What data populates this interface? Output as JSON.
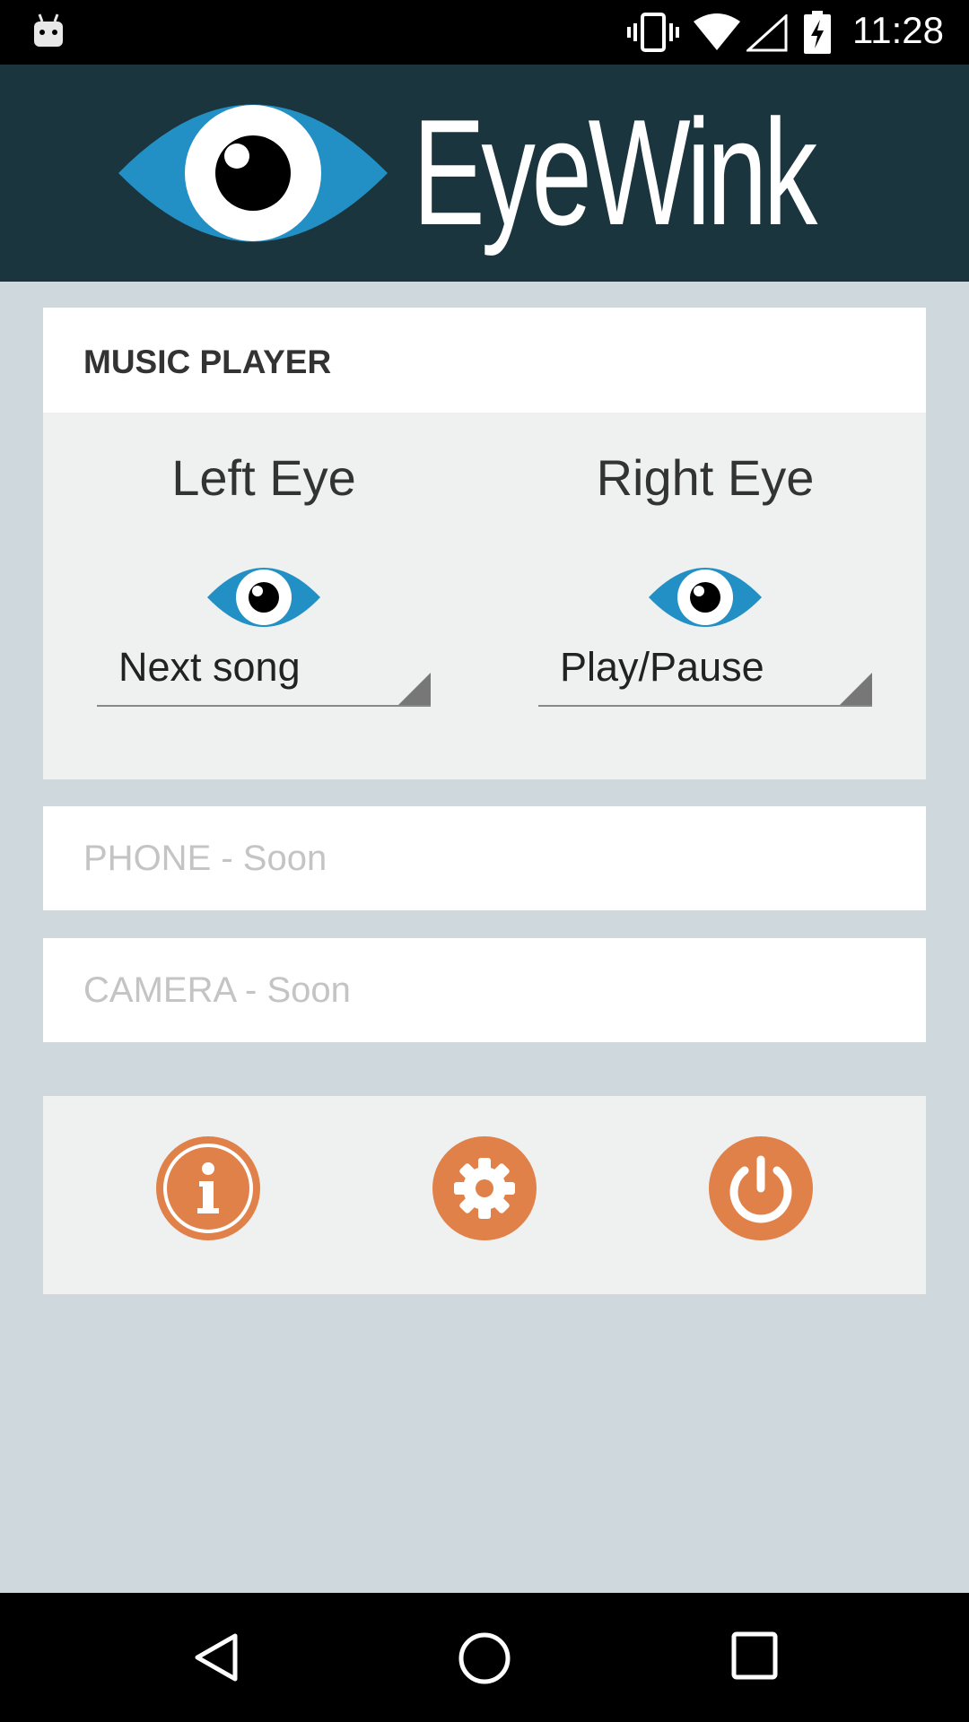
{
  "status_bar": {
    "time": "11:28",
    "icons": [
      "android-debug-icon",
      "vibrate-icon",
      "wifi-icon",
      "signal-icon",
      "battery-charging-icon"
    ]
  },
  "header": {
    "app_title": "EyeWink",
    "logo_icon": "eye-logo-icon",
    "background_color": "#1a353d",
    "eye_color": "#2290c4"
  },
  "music_card": {
    "title": "MUSIC PLAYER",
    "left": {
      "label": "Left Eye",
      "action": "Next song"
    },
    "right": {
      "label": "Right Eye",
      "action": "Play/Pause"
    }
  },
  "phone_card": {
    "label": "PHONE - Soon"
  },
  "camera_card": {
    "label": "CAMERA - Soon"
  },
  "actions": {
    "accent_color": "#e0814a",
    "buttons": [
      "info-icon",
      "settings-gear-icon",
      "power-icon"
    ]
  },
  "nav_bar": {
    "buttons": [
      "back-icon",
      "home-icon",
      "recents-icon"
    ]
  }
}
